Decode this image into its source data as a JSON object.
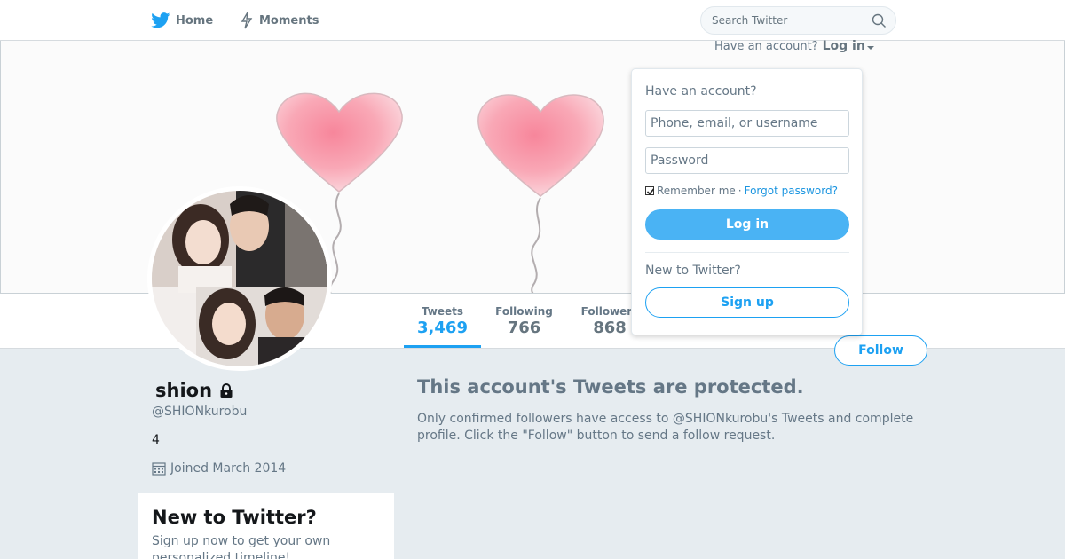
{
  "nav": {
    "home_label": "Home",
    "moments_label": "Moments",
    "search_placeholder": "Search Twitter"
  },
  "login_header": {
    "prompt": "Have an account?",
    "login_label": "Log in"
  },
  "login_dropdown": {
    "title": "Have an account?",
    "username_placeholder": "Phone, email, or username",
    "password_placeholder": "Password",
    "remember_label": "Remember me",
    "separator": "·",
    "forgot_label": "Forgot password?",
    "login_button": "Log in",
    "new_label": "New to Twitter?",
    "signup_button": "Sign up"
  },
  "stats": [
    {
      "label": "Tweets",
      "value": "3,469",
      "active": true
    },
    {
      "label": "Following",
      "value": "766",
      "active": false
    },
    {
      "label": "Followers",
      "value": "868",
      "active": false
    }
  ],
  "follow_button": "Follow",
  "profile": {
    "name_prefix": "",
    "name": "shion",
    "name_suffix": "",
    "screen_name": "@SHIONkurobu",
    "bio": "4",
    "joined": "Joined March 2014"
  },
  "protected": {
    "title": "This account's Tweets are protected.",
    "text": "Only confirmed followers have access to @SHIONkurobu's Tweets and complete profile. Click the \"Follow\" button to send a follow request."
  },
  "signup_card": {
    "title": "New to Twitter?",
    "text": "Sign up now to get your own personalized timeline!"
  },
  "colors": {
    "accent": "#1da1f2",
    "background": "#e6ecf0",
    "muted": "#657786"
  }
}
